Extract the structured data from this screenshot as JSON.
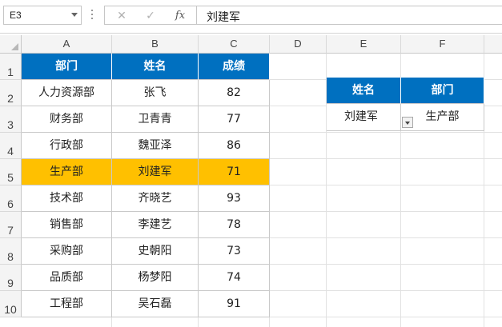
{
  "formula_bar": {
    "name_box": "E3",
    "cancel_icon": "✕",
    "enter_icon": "✓",
    "fx_label": "fx",
    "content": "刘建军"
  },
  "columns": [
    "A",
    "B",
    "C",
    "D",
    "E",
    "F"
  ],
  "rows": [
    "1",
    "2",
    "3",
    "4",
    "5",
    "6",
    "7",
    "8",
    "9",
    "10"
  ],
  "table": {
    "headers": [
      "部门",
      "姓名",
      "成绩"
    ],
    "rows": [
      [
        "人力资源部",
        "张飞",
        "82"
      ],
      [
        "财务部",
        "卫青青",
        "77"
      ],
      [
        "行政部",
        "魏亚泽",
        "86"
      ],
      [
        "生产部",
        "刘建军",
        "71"
      ],
      [
        "技术部",
        "齐晓艺",
        "93"
      ],
      [
        "销售部",
        "李建艺",
        "78"
      ],
      [
        "采购部",
        "史朝阳",
        "73"
      ],
      [
        "品质部",
        "杨梦阳",
        "74"
      ],
      [
        "工程部",
        "吴石磊",
        "91"
      ]
    ],
    "highlight_color": "#ffc000",
    "header_color": "#0070c0"
  },
  "lookup": {
    "headers": [
      "姓名",
      "部门"
    ],
    "name_value": "刘建军",
    "dept_value": "生产部"
  }
}
